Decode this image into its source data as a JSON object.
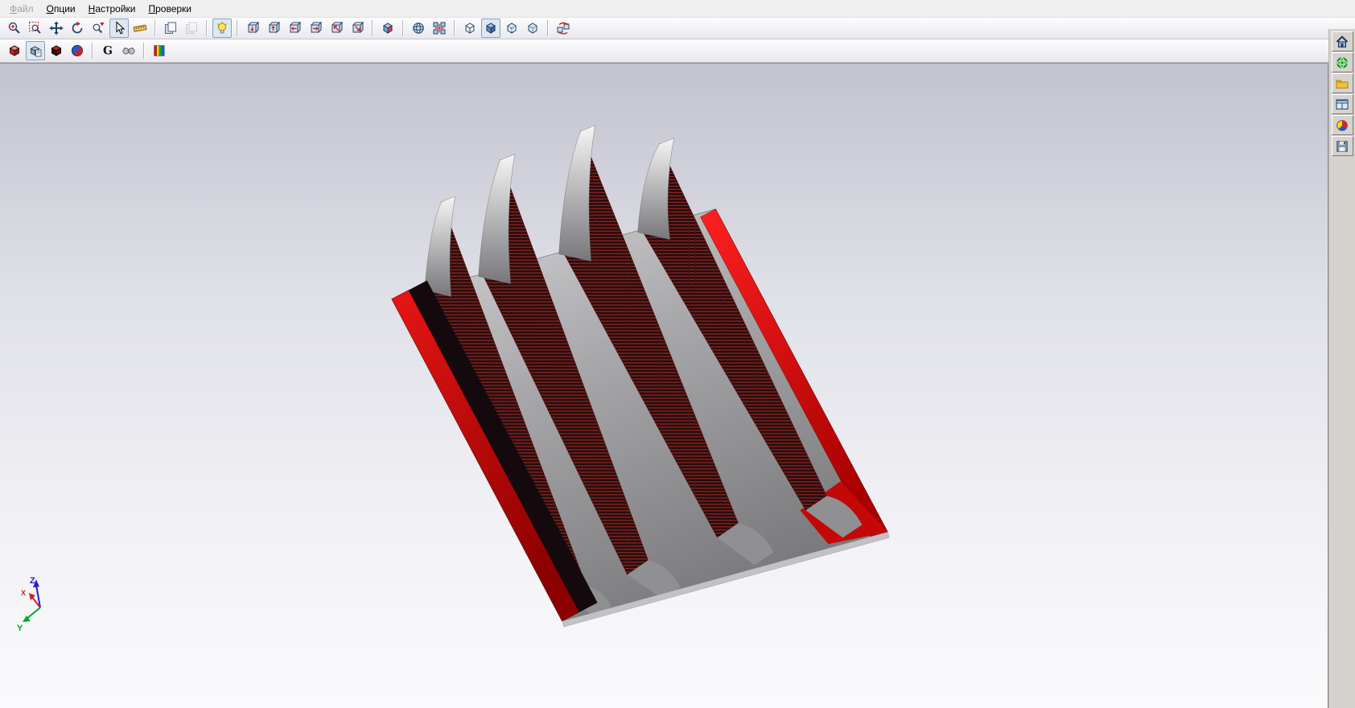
{
  "menu_bar": {
    "items": [
      {
        "label": "Файл",
        "enabled": false
      },
      {
        "label": "Опции",
        "enabled": true
      },
      {
        "label": "Настройки",
        "enabled": true
      },
      {
        "label": "Проверки",
        "enabled": true
      }
    ]
  },
  "toolbar_row1": {
    "groups": [
      [
        {
          "name": "zoom-in-icon"
        },
        {
          "name": "zoom-window-icon"
        },
        {
          "name": "pan-view-icon"
        },
        {
          "name": "rotate-view-icon"
        },
        {
          "name": "zoom-dynamic-icon"
        },
        {
          "name": "select-cursor-icon",
          "pressed": true
        },
        {
          "name": "measure-ruler-icon"
        }
      ],
      [
        {
          "name": "view-copy-icon"
        },
        {
          "name": "view-copy-disabled-icon",
          "disabled": true
        }
      ],
      [
        {
          "name": "light-bulb-icon",
          "pressed": true
        }
      ],
      [
        {
          "name": "view-front-icon"
        },
        {
          "name": "view-back-icon"
        },
        {
          "name": "view-left-icon"
        },
        {
          "name": "view-right-icon"
        },
        {
          "name": "view-top-icon"
        },
        {
          "name": "view-bottom-icon"
        }
      ],
      [
        {
          "name": "isometric-cube-icon"
        }
      ],
      [
        {
          "name": "sphere-view-icon"
        },
        {
          "name": "grid-snap-icon"
        }
      ],
      [
        {
          "name": "display-wireframe-icon"
        },
        {
          "name": "display-shaded-icon",
          "pressed": true
        },
        {
          "name": "display-hidden-line-icon"
        },
        {
          "name": "display-transparent-icon"
        }
      ],
      [
        {
          "name": "reverse-view-icon"
        }
      ]
    ]
  },
  "toolbar_row2": {
    "groups": [
      [
        {
          "name": "mesh-cube-red-icon"
        },
        {
          "name": "mesh-copy-icon",
          "pressed": true
        },
        {
          "name": "mesh-cube-dark-icon"
        },
        {
          "name": "mesh-swirl-icon"
        }
      ],
      [
        {
          "name": "letter-g-icon"
        },
        {
          "name": "binoculars-icon"
        }
      ],
      [
        {
          "name": "color-scale-icon"
        }
      ]
    ]
  },
  "right_dock": {
    "icons": [
      "home-icon",
      "globe-icon",
      "folder-icon",
      "window-layout-icon",
      "pie-sphere-icon",
      "save-icon"
    ]
  },
  "viewport": {
    "axis_triad": {
      "x_label": "X",
      "y_label": "Y",
      "z_label": "Z",
      "x_color": "#cc2222",
      "y_color": "#00aa22",
      "z_color": "#2222cc"
    },
    "model": {
      "type": "finned-part-3d-view",
      "fin_count": 4,
      "body_color_hex": "#9a9a9c",
      "highlight_face_color_hex": "#dd1111",
      "mesh_face_base_hex": "#200d0d",
      "mesh_line_color_hex": "#b02828"
    }
  }
}
